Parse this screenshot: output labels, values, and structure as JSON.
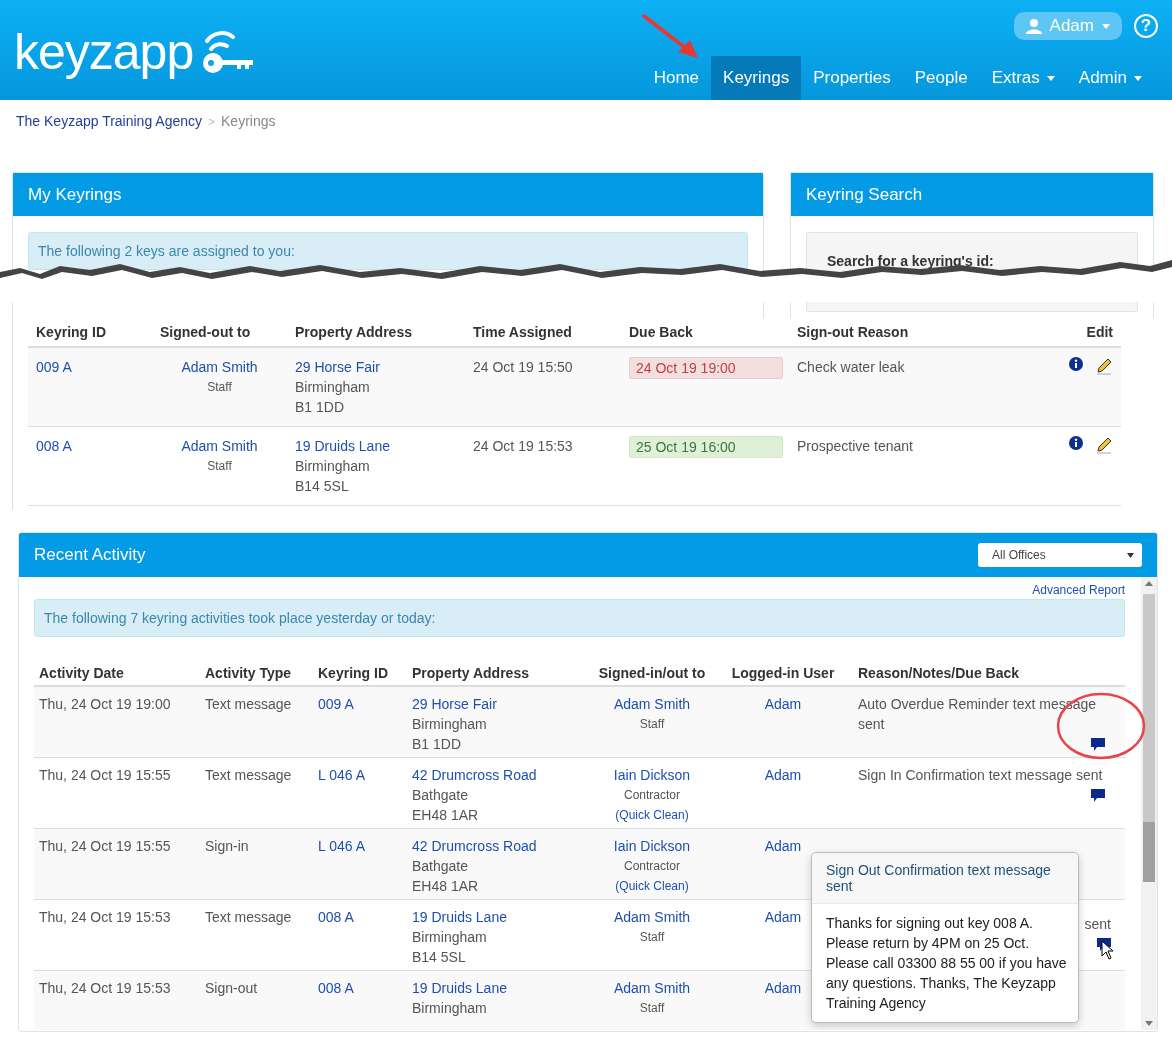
{
  "header": {
    "logo": "keyzapp",
    "user_menu": "Adam",
    "help": "?",
    "nav": [
      {
        "label": "Home",
        "selected": false,
        "dropdown": false
      },
      {
        "label": "Keyrings",
        "selected": true,
        "dropdown": false
      },
      {
        "label": "Properties",
        "selected": false,
        "dropdown": false
      },
      {
        "label": "People",
        "selected": false,
        "dropdown": false
      },
      {
        "label": "Extras",
        "selected": false,
        "dropdown": true
      },
      {
        "label": "Admin",
        "selected": false,
        "dropdown": true
      }
    ]
  },
  "breadcrumb": {
    "items": [
      "The Keyzapp Training Agency",
      "Keyrings"
    ],
    "separator": ">"
  },
  "my_keyrings": {
    "title": "My Keyrings",
    "notice": "The following 2 keys are assigned to you:",
    "columns": [
      "Keyring ID",
      "Signed-out to",
      "Property Address",
      "Time Assigned",
      "Due Back",
      "Sign-out Reason",
      "Edit"
    ],
    "rows": [
      {
        "keyring_id": "009 A",
        "person": "Adam Smith",
        "role": "Staff",
        "address": [
          "29 Horse Fair",
          "Birmingham",
          "B1 1DD"
        ],
        "time_assigned": "24 Oct 19 15:50",
        "due_back": "24 Oct 19 19:00",
        "overdue": true,
        "reason": "Check water leak"
      },
      {
        "keyring_id": "008 A",
        "person": "Adam Smith",
        "role": "Staff",
        "address": [
          "19 Druids Lane",
          "Birmingham",
          "B14 5SL"
        ],
        "time_assigned": "24 Oct 19 15:53",
        "due_back": "25 Oct 19 16:00",
        "overdue": false,
        "reason": "Prospective tenant"
      }
    ]
  },
  "keyring_search": {
    "title": "Keyring Search",
    "label": "Search for a keyring's id:"
  },
  "recent_activity": {
    "title": "Recent Activity",
    "office_filter": "All Offices",
    "advanced_report": "Advanced Report",
    "notice": "The following 7 keyring activities took place yesterday or today:",
    "columns": [
      "Activity Date",
      "Activity Type",
      "Keyring ID",
      "Property Address",
      "Signed-in/out to",
      "Logged-in User",
      "Reason/Notes/Due Back"
    ],
    "rows": [
      {
        "date": "Thu, 24 Oct 19 19:00",
        "type": "Text message",
        "keyring_id": "009 A",
        "address": [
          "29 Horse Fair",
          "Birmingham",
          "B1 1DD"
        ],
        "person": "Adam Smith",
        "role": "Staff",
        "user": "Adam",
        "reason": "Auto Overdue Reminder text message sent",
        "message": true,
        "reason_covered": false
      },
      {
        "date": "Thu, 24 Oct 19 15:55",
        "type": "Text message",
        "keyring_id": "L 046 A",
        "address": [
          "42 Drumcross Road",
          "Bathgate",
          "EH48 1AR"
        ],
        "person": "Iain Dickson",
        "role": "Contractor",
        "company": "(Quick Clean)",
        "user": "Adam",
        "reason": "Sign In Confirmation text message sent",
        "message": true,
        "reason_covered": false
      },
      {
        "date": "Thu, 24 Oct 19 15:55",
        "type": "Sign-in",
        "keyring_id": "L 046 A",
        "address": [
          "42 Drumcross Road",
          "Bathgate",
          "EH48 1AR"
        ],
        "person": "Iain Dickson",
        "role": "Contractor",
        "company": "(Quick Clean)",
        "user": "Adam",
        "message": false
      },
      {
        "date": "Thu, 24 Oct 19 15:53",
        "type": "Text message",
        "keyring_id": "008 A",
        "address": [
          "19 Druids Lane",
          "Birmingham",
          "B14 5SL"
        ],
        "person": "Adam Smith",
        "role": "Staff",
        "user": "Adam",
        "reason": "sent",
        "message": true,
        "reason_covered": true
      },
      {
        "date": "Thu, 24 Oct 19 15:53",
        "type": "Sign-out",
        "keyring_id": "008 A",
        "address": [
          "19 Druids Lane",
          "Birmingham"
        ],
        "person": "Adam Smith",
        "role": "Staff",
        "user": "Adam",
        "message": false
      }
    ]
  },
  "popover": {
    "title": "Sign Out Confirmation text message sent",
    "body": "Thanks for signing out key 008 A. Please return by 4PM on 25 Oct. Please call 03300 88 55 00 if you have any questions. Thanks, The Keyzapp Training Agency"
  }
}
